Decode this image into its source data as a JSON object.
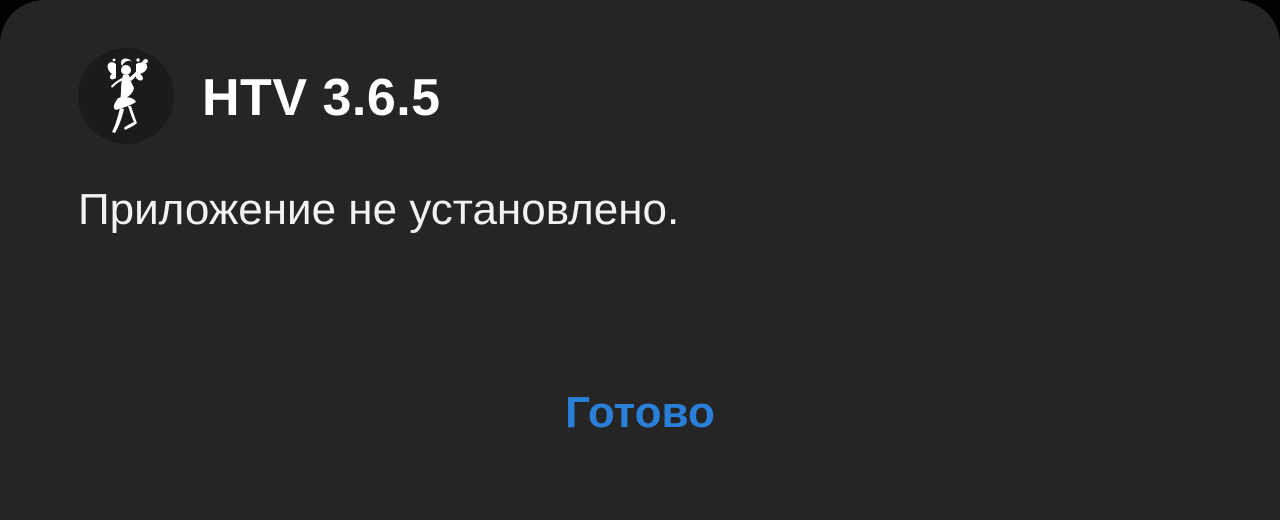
{
  "dialog": {
    "app_icon": "fairy-silhouette-icon",
    "app_name": "HTV 3.6.5",
    "message": "Приложение не установлено.",
    "done_label": "Готово"
  },
  "colors": {
    "dialog_background": "#252525",
    "accent": "#2a7fd8",
    "title_text": "#ffffff",
    "body_text": "#f2f2f2"
  }
}
